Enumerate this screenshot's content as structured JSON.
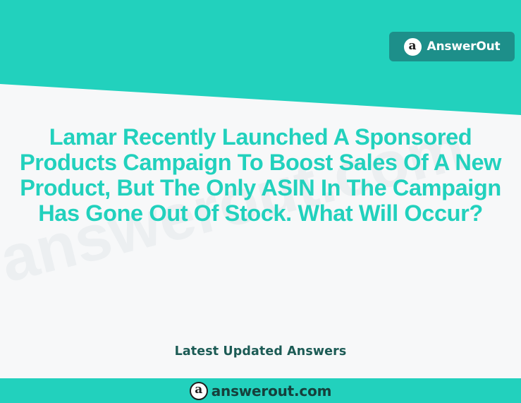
{
  "brand": {
    "logo_letter": "a",
    "name": "AnswerOut"
  },
  "question": {
    "text": "Lamar Recently Launched A Sponsored Products Campaign To Boost Sales Of A New Product, But The Only ASIN In The Campaign Has Gone Out Of Stock. What Will Occur?"
  },
  "watermark": {
    "text": "answerout.com"
  },
  "tagline": {
    "text": "Latest Updated Answers"
  },
  "footer": {
    "logo_letter": "a",
    "site": "answerout.com"
  },
  "colors": {
    "accent": "#22d1bd",
    "badge": "#1d8f8a",
    "background": "#f7f8f9",
    "tagline": "#1c5b55",
    "footer_text": "#16403c"
  },
  "icons": {
    "brand_logo": "answerout-logo-icon",
    "footer_logo": "answerout-logo-icon"
  }
}
